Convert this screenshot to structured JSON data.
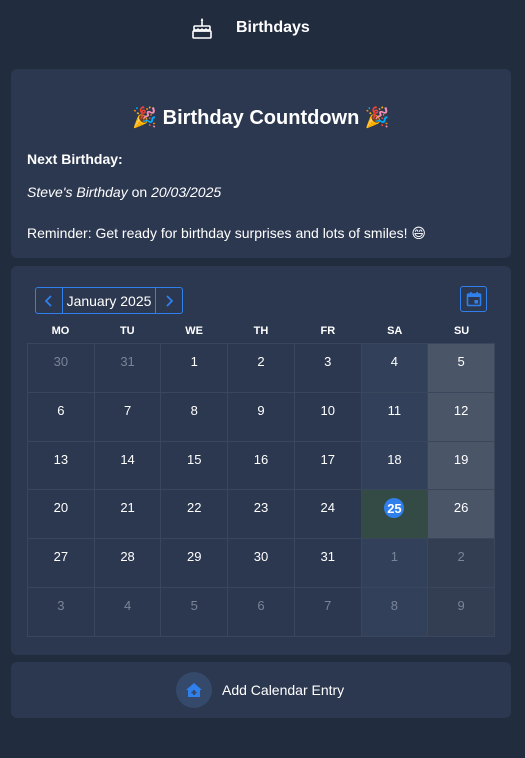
{
  "header": {
    "title": "Birthdays",
    "icon": "cake-icon"
  },
  "countdown": {
    "title": "Birthday Countdown",
    "title_emoji": "🎉",
    "next_label": "Next Birthday:",
    "next_name": "Steve's Birthday",
    "next_on": " on ",
    "next_date": "20/03/2025",
    "reminder": "Reminder: Get ready for birthday surprises and lots of smiles! 😄"
  },
  "calendar": {
    "month_label": "January 2025",
    "prev_icon": "chevron-left-icon",
    "next_icon": "chevron-right-icon",
    "today_icon": "calendar-today-icon",
    "weekdays": [
      "MO",
      "TU",
      "WE",
      "TH",
      "FR",
      "SA",
      "SU"
    ],
    "today": "25",
    "weeks": [
      [
        "30",
        "31",
        "1",
        "2",
        "3",
        "4",
        "5"
      ],
      [
        "6",
        "7",
        "8",
        "9",
        "10",
        "11",
        "12"
      ],
      [
        "13",
        "14",
        "15",
        "16",
        "17",
        "18",
        "19"
      ],
      [
        "20",
        "21",
        "22",
        "23",
        "24",
        "25",
        "26"
      ],
      [
        "27",
        "28",
        "29",
        "30",
        "31",
        "1",
        "2"
      ],
      [
        "3",
        "4",
        "5",
        "6",
        "7",
        "8",
        "9"
      ]
    ]
  },
  "add_entry": {
    "label": "Add Calendar Entry",
    "icon": "home-add-icon"
  },
  "colors": {
    "accent": "#2f80ed",
    "background": "#222c3f",
    "card": "#2c3850"
  }
}
